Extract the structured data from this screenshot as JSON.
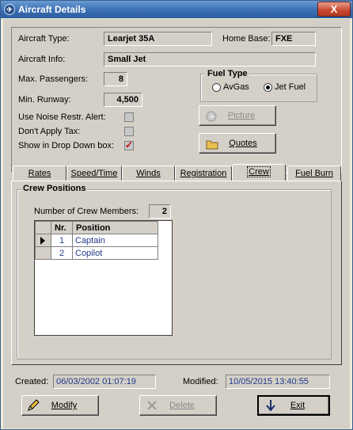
{
  "window": {
    "title": "Aircraft Details",
    "close_glyph": "X"
  },
  "aircraft": {
    "type_label": "Aircraft Type:",
    "type_value": "Learjet 35A",
    "home_base_label": "Home Base:",
    "home_base_value": "FXE",
    "info_label": "Aircraft Info:",
    "info_value": "Small Jet",
    "max_passengers_label": "Max. Passengers:",
    "max_passengers_value": "8",
    "min_runway_label": "Min. Runway:",
    "min_runway_value": "4,500",
    "noise_alert_label": "Use Noise Restr. Alert:",
    "noise_alert_checked": false,
    "no_tax_label": "Don't Apply Tax:",
    "no_tax_checked": false,
    "dropdown_label": "Show in Drop Down box:",
    "dropdown_checked": true
  },
  "fuel_type": {
    "title": "Fuel Type",
    "options": [
      "AvGas",
      "Jet Fuel"
    ],
    "selected": "Jet Fuel"
  },
  "buttons": {
    "picture": "Picture",
    "quotes": "Quotes",
    "modify": "Modify",
    "delete": "Delete",
    "exit": "Exit"
  },
  "tabs": [
    "Rates",
    "Speed/Time",
    "Winds",
    "Registration",
    "Crew",
    "Fuel Burn"
  ],
  "active_tab": "Crew",
  "crew": {
    "group_title": "Crew Positions",
    "count_label": "Number of Crew Members:",
    "count_value": "2",
    "columns": [
      "Nr.",
      "Position"
    ],
    "rows": [
      {
        "nr": "1",
        "position": "Captain"
      },
      {
        "nr": "2",
        "position": "Copilot"
      }
    ]
  },
  "footer": {
    "created_label": "Created:",
    "created_value": "06/03/2002 01:07:19",
    "modified_label": "Modified:",
    "modified_value": "10/05/2015 13:40:55"
  },
  "colors": {
    "titlebar": "#3b6eb3",
    "value_text": "#1f3a8a",
    "check_mark": "#c00000"
  }
}
